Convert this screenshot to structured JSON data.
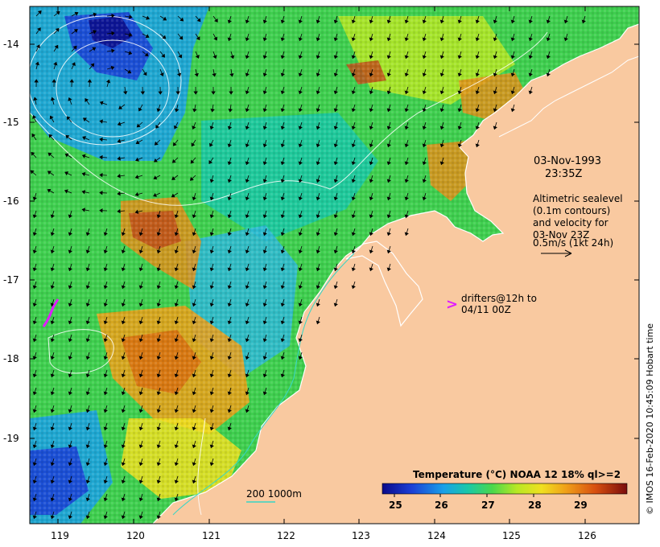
{
  "map": {
    "lon_ticks": [
      "119",
      "120",
      "121",
      "122",
      "123",
      "124",
      "125",
      "126"
    ],
    "lat_ticks": [
      "-14",
      "-15",
      "-16",
      "-17",
      "-18",
      "-19"
    ],
    "date_line1": "03-Nov-1993",
    "date_line2": "23:35Z",
    "altimetric_lines": [
      "Altimetric sealevel",
      "(0.1m contours)",
      "and velocity for",
      "03-Nov 23Z",
      "0.5m/s (1kt 24h)"
    ],
    "drifters_marker": ">",
    "drifters_line1": "drifters@12h to",
    "drifters_line2": "04/11 00Z",
    "depth_label": "200  1000m",
    "colorbar_title": "Temperature (°C) NOAA 12 18% ql>=2",
    "colorbar_ticks": [
      "25",
      "26",
      "27",
      "28",
      "29"
    ],
    "credit": "© IMOS 16-Feb-2020 10:45:09 Hobart time",
    "colors": {
      "land": "#f9c9a0",
      "drifter": "#e01cff",
      "contour": "#ffffff",
      "isobath": "#37d6c6"
    }
  }
}
